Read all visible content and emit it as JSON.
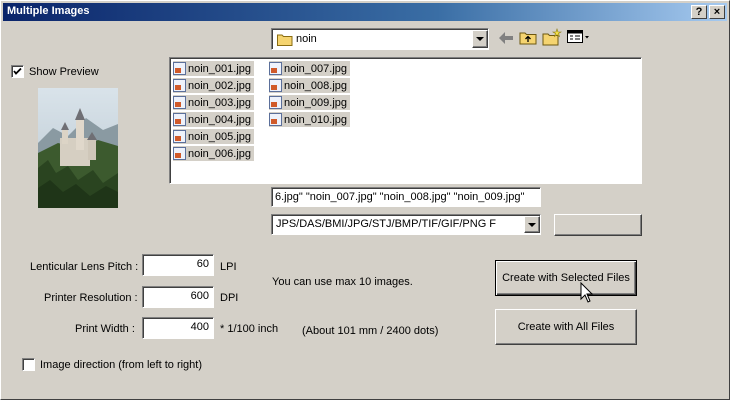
{
  "window": {
    "title": "Multiple Images",
    "help_btn": "?",
    "close_btn": "×"
  },
  "preview": {
    "show_label": "Show Preview",
    "checked": true
  },
  "folder": {
    "name": "noin"
  },
  "files": {
    "col1": [
      "noin_001.jpg",
      "noin_002.jpg",
      "noin_003.jpg",
      "noin_004.jpg",
      "noin_005.jpg",
      "noin_006.jpg"
    ],
    "col2": [
      "noin_007.jpg",
      "noin_008.jpg",
      "noin_009.jpg",
      "noin_010.jpg"
    ]
  },
  "filename_field": "6.jpg\"  \"noin_007.jpg\"  \"noin_008.jpg\"  \"noin_009.jpg\"",
  "filetype": "JPS/DAS/BMI/JPG/STJ/BMP/TIF/GIF/PNG F",
  "settings": {
    "pitch_label": "Lenticular Lens Pitch :",
    "pitch_value": "60",
    "pitch_unit": "LPI",
    "resolution_label": "Printer Resolution :",
    "resolution_value": "600",
    "resolution_unit": "DPI",
    "width_label": "Print Width :",
    "width_value": "400",
    "width_unit": "* 1/100 inch",
    "size_info": "(About 101 mm / 2400 dots)",
    "max_info": "You can use max 10 images."
  },
  "direction": {
    "label": "Image direction (from left to right)",
    "checked": false
  },
  "buttons": {
    "create_selected": "Create with Selected Files",
    "create_all": "Create with All Files"
  }
}
